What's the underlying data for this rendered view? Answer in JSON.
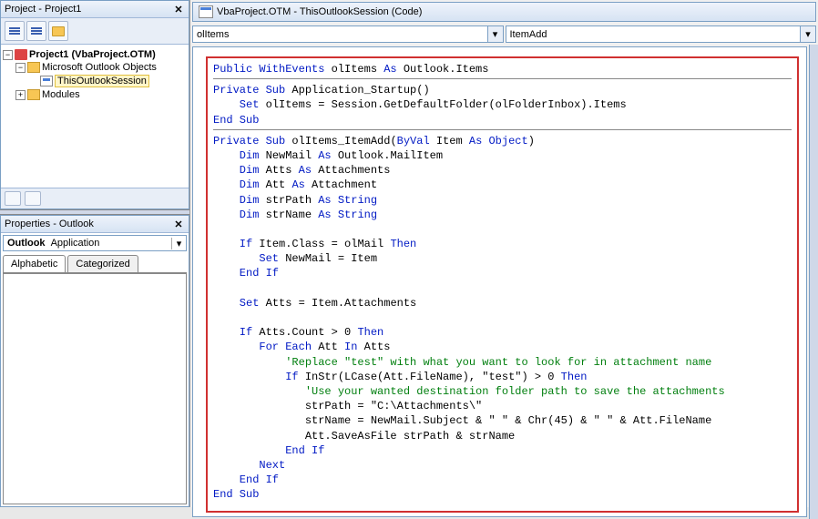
{
  "project_pane": {
    "title": "Project - Project1",
    "tree": {
      "root": "Project1 (VbaProject.OTM)",
      "folder1": "Microsoft Outlook Objects",
      "item1": "ThisOutlookSession",
      "folder2": "Modules"
    }
  },
  "props_pane": {
    "title": "Properties - Outlook",
    "combo_bold": "Outlook",
    "combo_norm": "Application",
    "tab1": "Alphabetic",
    "tab2": "Categorized"
  },
  "code_window": {
    "title": "VbaProject.OTM - ThisOutlookSession (Code)",
    "object_combo": "olItems",
    "proc_combo": "ItemAdd"
  },
  "code": {
    "l01a": "Public WithEvents",
    "l01b": " olItems ",
    "l01c": "As",
    "l01d": " Outlook.Items",
    "sp": " ",
    "l03a": "Private Sub",
    "l03b": " Application_Startup()",
    "l04a": "    Set",
    "l04b": " olItems = Session.GetDefaultFolder(olFolderInbox).Items",
    "l05a": "End Sub",
    "l07a": "Private Sub",
    "l07b": " olItems_ItemAdd(",
    "l07c": "ByVal",
    "l07d": " Item ",
    "l07e": "As Object",
    "l07f": ")",
    "l08a": "    Dim",
    "l08b": " NewMail ",
    "l08c": "As",
    "l08d": " Outlook.MailItem",
    "l09a": "    Dim",
    "l09b": " Atts ",
    "l09c": "As",
    "l09d": " Attachments",
    "l10a": "    Dim",
    "l10b": " Att ",
    "l10c": "As",
    "l10d": " Attachment",
    "l11a": "    Dim",
    "l11b": " strPath ",
    "l11c": "As String",
    "l12a": "    Dim",
    "l12b": " strName ",
    "l12c": "As String",
    "l14a": "    If",
    "l14b": " Item.Class = olMail ",
    "l14c": "Then",
    "l15a": "       Set",
    "l15b": " NewMail = Item",
    "l16a": "    End If",
    "l18a": "    Set",
    "l18b": " Atts = Item.Attachments",
    "l20a": "    If",
    "l20b": " Atts.Count > 0 ",
    "l20c": "Then",
    "l21a": "       For Each",
    "l21b": " Att ",
    "l21c": "In",
    "l21d": " Atts",
    "l22a": "           'Replace \"test\" with what you want to look for in attachment name",
    "l23a": "           If",
    "l23b": " InStr(LCase(Att.FileName), \"test\") > 0 ",
    "l23c": "Then",
    "l24a": "              'Use your wanted destination folder path to save the attachments",
    "l25a": "              strPath = \"C:\\Attachments\\\"",
    "l26a": "              strName = NewMail.Subject & \" \" & Chr(45) & \" \" & Att.FileName",
    "l27a": "              Att.SaveAsFile strPath & strName",
    "l28a": "           End If",
    "l29a": "       Next",
    "l30a": "    End If",
    "l31a": "End Sub"
  }
}
